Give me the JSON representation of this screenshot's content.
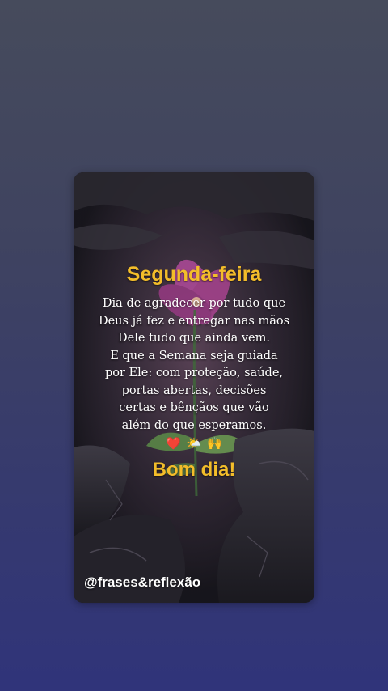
{
  "post": {
    "title": "Segunda-feira",
    "message_lines": [
      "Dia de agradecer por tudo que",
      "Deus já fez e entregar nas mãos",
      "Dele tudo que ainda vem.",
      "E que a Semana seja guiada",
      "por Ele: com proteção, saúde,",
      "portas abertas, decisões",
      "certas e bênçãos que vão",
      "além do que esperamos."
    ],
    "emojis": {
      "heart": "❤️",
      "sun_cloud": "🌤️",
      "raised_hands": "🙌"
    },
    "greeting": "Bom dia!",
    "handle": "@frases&reflexão"
  },
  "colors": {
    "accent_gold": "#f3bd2a",
    "text_white": "#ffffff",
    "background_top": "#464b5c",
    "background_bottom": "#30347a",
    "flower_pink": "#b04a9a"
  },
  "icons": {
    "background_image": "flower-on-rocks-photo"
  }
}
